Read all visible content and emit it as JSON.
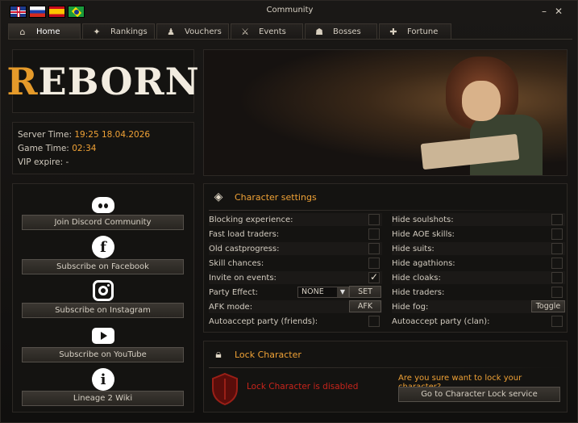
{
  "window": {
    "title": "Community"
  },
  "tabs": [
    {
      "label": "Home",
      "icon": "home-icon",
      "glyph": "⌂"
    },
    {
      "label": "Rankings",
      "icon": "rankings-icon",
      "glyph": "✦"
    },
    {
      "label": "Vouchers",
      "icon": "vouchers-icon",
      "glyph": "♟"
    },
    {
      "label": "Events",
      "icon": "events-icon",
      "glyph": "⚔"
    },
    {
      "label": "Bosses",
      "icon": "bosses-icon",
      "glyph": "☗"
    },
    {
      "label": "Fortune",
      "icon": "fortune-icon",
      "glyph": "✚"
    }
  ],
  "logo": {
    "first": "R",
    "rest": "EBORN"
  },
  "info": {
    "server_time_label": "Server Time:",
    "server_time_value": "19:25 18.04.2026",
    "game_time_label": "Game Time:",
    "game_time_value": "02:34",
    "vip_label": "VIP expire:",
    "vip_value": "-"
  },
  "social": [
    {
      "icon": "discord-icon",
      "label": "Join Discord Community"
    },
    {
      "icon": "facebook-icon",
      "label": "Subscribe on Facebook",
      "glyph": "f"
    },
    {
      "icon": "instagram-icon",
      "label": "Subscribe on Instagram"
    },
    {
      "icon": "youtube-icon",
      "label": "Subscribe on YouTube"
    },
    {
      "icon": "wiki-icon",
      "label": "Lineage 2 Wiki",
      "glyph": "i"
    }
  ],
  "settings": {
    "title": "Character settings",
    "left": [
      {
        "label": "Blocking experience:",
        "checked": false
      },
      {
        "label": "Fast load traders:",
        "checked": false
      },
      {
        "label": "Old castprogress:",
        "checked": false
      },
      {
        "label": "Skill chances:",
        "checked": false
      },
      {
        "label": "Invite on events:",
        "checked": true
      },
      {
        "label": "Party Effect:"
      },
      {
        "label": "AFK mode:"
      },
      {
        "label": "Autoaccept party (friends):",
        "checked": false
      }
    ],
    "right": [
      {
        "label": "Hide soulshots:",
        "checked": false
      },
      {
        "label": "Hide AOE skills:",
        "checked": false
      },
      {
        "label": "Hide suits:",
        "checked": false
      },
      {
        "label": "Hide agathions:",
        "checked": false
      },
      {
        "label": "Hide cloaks:",
        "checked": false
      },
      {
        "label": "Hide traders:",
        "checked": false
      },
      {
        "label": "Hide fog:"
      },
      {
        "label": "Autoaccept party (clan):",
        "checked": false
      }
    ],
    "party_effect_value": "NONE",
    "set_label": "SET",
    "afk_label": "AFK",
    "toggle_label": "Toggle"
  },
  "lock": {
    "title": "Lock Character",
    "status": "Lock Character is disabled",
    "question": "Are you sure want to lock your character?",
    "button": "Go to Character Lock service"
  },
  "colors": {
    "accent": "#f0a236",
    "danger": "#c8241b",
    "background": "#141311"
  }
}
